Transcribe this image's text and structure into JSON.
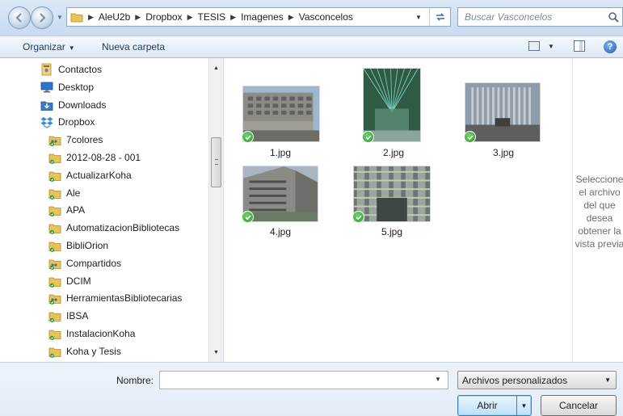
{
  "address": {
    "crumbs": [
      "AleU2b",
      "Dropbox",
      "TESIS",
      "Imagenes",
      "Vasconcelos"
    ]
  },
  "search": {
    "placeholder": "Buscar Vasconcelos"
  },
  "toolbar": {
    "organize_label": "Organizar",
    "new_folder_label": "Nueva carpeta"
  },
  "tree": {
    "items": [
      {
        "label": "Contactos",
        "icon": "contacts-icon",
        "indent": 0
      },
      {
        "label": "Desktop",
        "icon": "desktop-icon",
        "indent": 0
      },
      {
        "label": "Downloads",
        "icon": "downloads-icon",
        "indent": 0
      },
      {
        "label": "Dropbox",
        "icon": "dropbox-icon",
        "indent": 0
      },
      {
        "label": "7colores",
        "icon": "shared-folder-icon",
        "indent": 1
      },
      {
        "label": "2012-08-28 - 001",
        "icon": "folder-synced-icon",
        "indent": 1
      },
      {
        "label": "ActualizarKoha",
        "icon": "folder-synced-icon",
        "indent": 1
      },
      {
        "label": "Ale",
        "icon": "folder-synced-icon",
        "indent": 1
      },
      {
        "label": "APA",
        "icon": "folder-synced-icon",
        "indent": 1
      },
      {
        "label": "AutomatizacionBibliotecas",
        "icon": "folder-synced-icon",
        "indent": 1
      },
      {
        "label": "BibliOrion",
        "icon": "folder-synced-icon",
        "indent": 1
      },
      {
        "label": "Compartidos",
        "icon": "shared-folder-icon",
        "indent": 1
      },
      {
        "label": "DCIM",
        "icon": "folder-synced-icon",
        "indent": 1
      },
      {
        "label": "HerramientasBibliotecarias",
        "icon": "shared-folder-icon",
        "indent": 1
      },
      {
        "label": "IBSA",
        "icon": "folder-synced-icon",
        "indent": 1
      },
      {
        "label": "InstalacionKoha",
        "icon": "folder-synced-icon",
        "indent": 1
      },
      {
        "label": "Koha y Tesis",
        "icon": "folder-synced-icon",
        "indent": 1
      }
    ]
  },
  "files": [
    {
      "name": "1.jpg",
      "status": "synced"
    },
    {
      "name": "2.jpg",
      "status": "synced"
    },
    {
      "name": "3.jpg",
      "status": "synced"
    },
    {
      "name": "4.jpg",
      "status": "synced"
    },
    {
      "name": "5.jpg",
      "status": "synced"
    }
  ],
  "preview": {
    "lines": [
      "Seleccione",
      "el archivo",
      "del que",
      "desea",
      "obtener la",
      "vista previa"
    ]
  },
  "bottom": {
    "name_label": "Nombre:",
    "name_value": "",
    "filter_value": "Archivos personalizados",
    "open_label": "Abrir",
    "cancel_label": "Cancelar"
  },
  "colors": {
    "accent": "#3c7fb1",
    "sync_green": "#2c9a2a",
    "folder_yellow": "#e8c25a"
  }
}
